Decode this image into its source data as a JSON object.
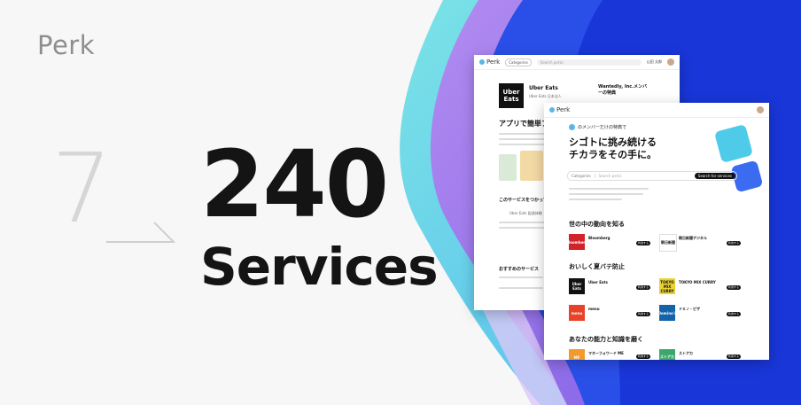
{
  "brand": "Perk",
  "headline": {
    "previous_count": "7",
    "count": "240",
    "unit": "Services"
  },
  "colors": {
    "background": "#f7f7f7",
    "accent_blue": "#1d3ee0",
    "text_dark": "#141414",
    "text_gray": "#8e8e8e",
    "faint_gray": "#d6d6d6"
  },
  "back_screen": {
    "logo": "Perk",
    "category_pill": "Categories",
    "search_placeholder": "Search perks",
    "user_name": "山田 太郎",
    "service_name": "Uber Eats",
    "service_logo": "Uber Eats",
    "provider": "Uber Eats 日本法人",
    "side_note": "Wantedly, Inc.メンバーの特典",
    "section_title": "アプリで簡単フー",
    "related_title": "このサービスをつかっている",
    "related_item": "Uber Eats 配達体験",
    "recommend_title": "おすすめのサービス"
  },
  "front_screen": {
    "logo": "Perk",
    "badge": "のメンバーだけの特典で",
    "hero_title_line1": "シゴトに挑み続ける",
    "hero_title_line2": "チカラをその手に。",
    "category_select": "Categories",
    "search_placeholder": "Search perks",
    "search_button": "Search for services",
    "sections": [
      {
        "title": "世の中の動向を知る",
        "services": [
          {
            "name": "Bloomberg",
            "logo_text": "Bloomberg",
            "logo_color": "#d2232a"
          },
          {
            "name": "朝日新聞デジタル",
            "logo_text": "朝日新聞",
            "logo_color": "#ffffff"
          }
        ]
      },
      {
        "title": "おいしく夏バテ防止",
        "services": [
          {
            "name": "Uber Eats",
            "logo_text": "Uber Eats",
            "logo_color": "#111111"
          },
          {
            "name": "TOKYO MIX CURRY",
            "logo_text": "TOKYO MIX CURRY",
            "logo_color": "#e8d23a"
          },
          {
            "name": "menu",
            "logo_text": "menu",
            "logo_color": "#e8432a"
          },
          {
            "name": "ドミノ・ピザ",
            "logo_text": "Domino's",
            "logo_color": "#1463a8"
          }
        ]
      },
      {
        "title": "あなたの能力と知識を磨く",
        "services": [
          {
            "name": "マネーフォワード ME",
            "logo_text": "MF",
            "logo_color": "#f29a2e"
          },
          {
            "name": "ストアカ",
            "logo_text": "ストアカ",
            "logo_color": "#3aa86b"
          }
        ]
      }
    ],
    "button_label": "利用する"
  }
}
